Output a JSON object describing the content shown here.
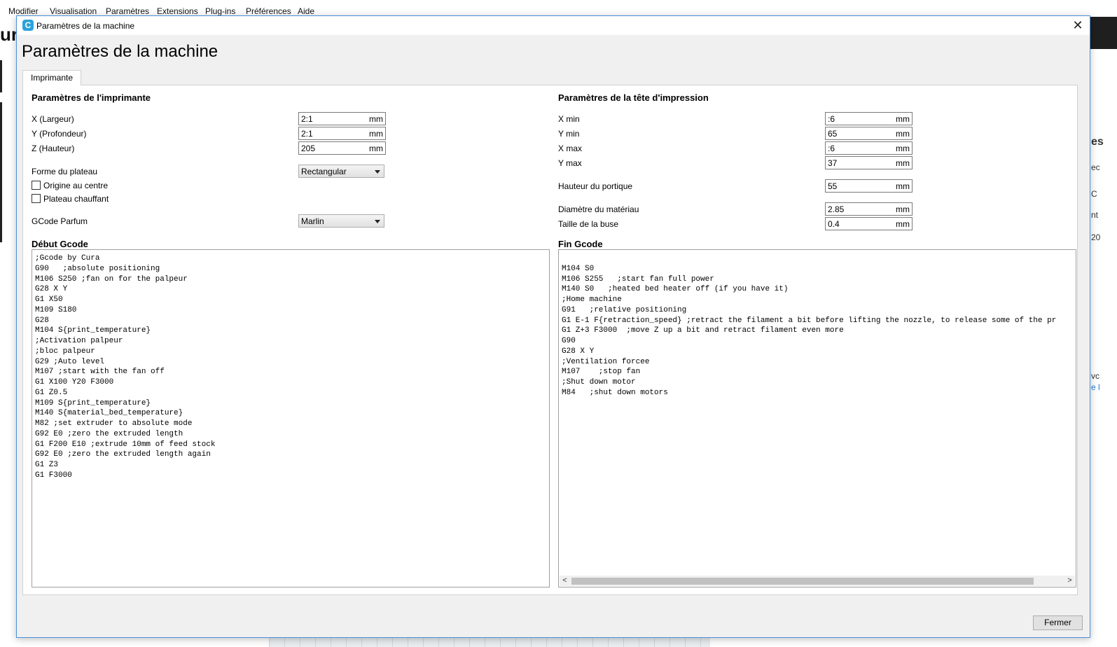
{
  "background": {
    "menu": [
      "Modifier",
      "Visualisation",
      "Paramètres",
      "Extensions",
      "Plug-ins",
      "Préférences",
      "Aide"
    ],
    "logo_fragment": "ur",
    "right_fragments": [
      "es",
      "ec",
      "C",
      "nt",
      "20",
      "vc",
      "e l"
    ]
  },
  "dialog": {
    "window_title": "Paramètres de la machine",
    "app_icon": "C",
    "heading": "Paramètres de la machine",
    "close_icon": "✕",
    "tab_label": "Imprimante",
    "close_button_label": "Fermer"
  },
  "printer": {
    "section_title": "Paramètres de l'imprimante",
    "x_label": "X (Largeur)",
    "x_value": "2:1",
    "y_label": "Y (Profondeur)",
    "y_value": "2:1",
    "z_label": "Z (Hauteur)",
    "z_value": "205",
    "unit": "mm",
    "bed_shape_label": "Forme du plateau",
    "bed_shape_value": "Rectangular",
    "origin_center_label": "Origine au centre",
    "origin_center_checked": false,
    "heated_bed_label": "Plateau chauffant",
    "heated_bed_checked": false,
    "gcode_flavor_label": "GCode Parfum",
    "gcode_flavor_value": "Marlin"
  },
  "printhead": {
    "section_title": "Paramètres de la tête d'impression",
    "xmin_label": "X min",
    "xmin_value": ":6",
    "ymin_label": "Y min",
    "ymin_value": "65",
    "xmax_label": "X max",
    "xmax_value": ":6",
    "ymax_label": "Y max",
    "ymax_value": "37",
    "gantry_label": "Hauteur du portique",
    "gantry_value": "55",
    "material_diameter_label": "Diamètre du matériau",
    "material_diameter_value": "2.85",
    "nozzle_label": "Taille de la buse",
    "nozzle_value": "0.4",
    "unit": "mm"
  },
  "start_gcode": {
    "title": "Début Gcode",
    "text": ";Gcode by Cura\nG90   ;absolute positioning\nM106 S250 ;fan on for the palpeur\nG28 X Y\nG1 X50\nM109 S180\nG28\nM104 S{print_temperature}\n;Activation palpeur\n;bloc palpeur\nG29 ;Auto level\nM107 ;start with the fan off\nG1 X100 Y20 F3000\nG1 Z0.5\nM109 S{print_temperature}\nM140 S{material_bed_temperature}\nM82 ;set extruder to absolute mode\nG92 E0 ;zero the extruded length\nG1 F200 E10 ;extrude 10mm of feed stock\nG92 E0 ;zero the extruded length again\nG1 Z3\nG1 F3000"
  },
  "end_gcode": {
    "title": "Fin Gcode",
    "text": "\nM104 S0\nM106 S255   ;start fan full power\nM140 S0   ;heated bed heater off (if you have it)\n;Home machine\nG91   ;relative positioning\nG1 E-1 F{retraction_speed} ;retract the filament a bit before lifting the nozzle, to release some of the pr\nG1 Z+3 F3000  ;move Z up a bit and retract filament even more\nG90\nG28 X Y\n;Ventilation forcee\nM107    ;stop fan\n;Shut down motor\nM84   ;shut down motors",
    "scroll_left": "<",
    "scroll_right": ">"
  }
}
